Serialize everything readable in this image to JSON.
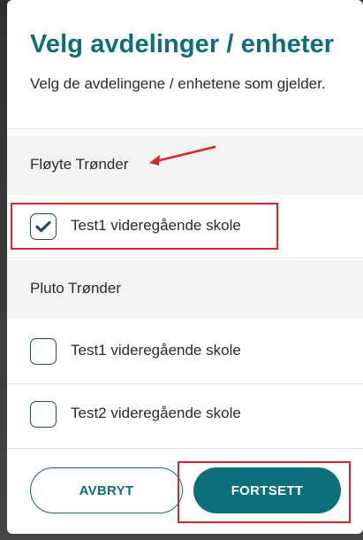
{
  "dialog": {
    "title": "Velg avdelinger / enheter",
    "subtitle": "Velg de avdelingene / enhetene som gjelder."
  },
  "groups": [
    {
      "label": "Fløyte Trønder",
      "options": [
        {
          "label": "Test1 videregående skole",
          "checked": true
        }
      ]
    },
    {
      "label": "Pluto Trønder",
      "options": [
        {
          "label": "Test1 videregående skole",
          "checked": false
        },
        {
          "label": "Test2 videregående skole",
          "checked": false
        }
      ]
    }
  ],
  "buttons": {
    "cancel_label": "AVBRYT",
    "continue_label": "FORTSETT"
  },
  "colors": {
    "accent": "#0d6f7a",
    "checkbox_border": "#1d4f63",
    "annotation": "#d7262f"
  },
  "icons": {
    "checkmark": "check-icon",
    "annotation_arrow": "arrow-icon"
  }
}
